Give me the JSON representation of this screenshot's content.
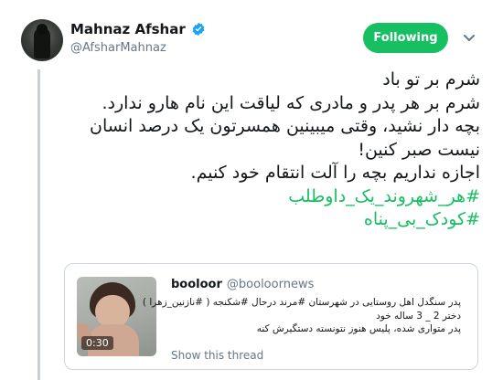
{
  "author": {
    "name": "Mahnaz Afshar",
    "handle": "@AfsharMahnaz",
    "verified": true
  },
  "follow_button": {
    "label": "Following",
    "color": "#17bf63"
  },
  "tweet": {
    "lines": [
      "شرم بر تو باد",
      "شرم بر هر پدر و مادری که لیاقت این نام هارو ندارد.",
      "بچه دار نشید، وقتی میبینین همسرتون یک درصد انسان",
      "نیست صبر کنین!",
      "اجازه نداریم  بچه را آلت انتقام خود کنیم."
    ],
    "hashtags": [
      "#هر_شهروند_یک_داوطلب",
      "#کودک_بی_پناه"
    ]
  },
  "quoted_tweet": {
    "name": "booloor",
    "handle": "@booloornews",
    "media_duration": "0:30",
    "lines": [
      "پدر سنگدل اهل روستایی در شهرستان #مرند درحال #شکنجه ( #نازنین_زهرا )",
      "دختر 2 _ 3 ساله خود",
      "پدر متواری شده، پلیس هنوز نتونسته دستگیرش کنه"
    ],
    "show_thread": "Show this thread"
  },
  "colors": {
    "accent": "#17bf63",
    "verified_blue": "#1da1f2",
    "secondary_text": "#657786",
    "thread_line": "#c6cfd5"
  }
}
